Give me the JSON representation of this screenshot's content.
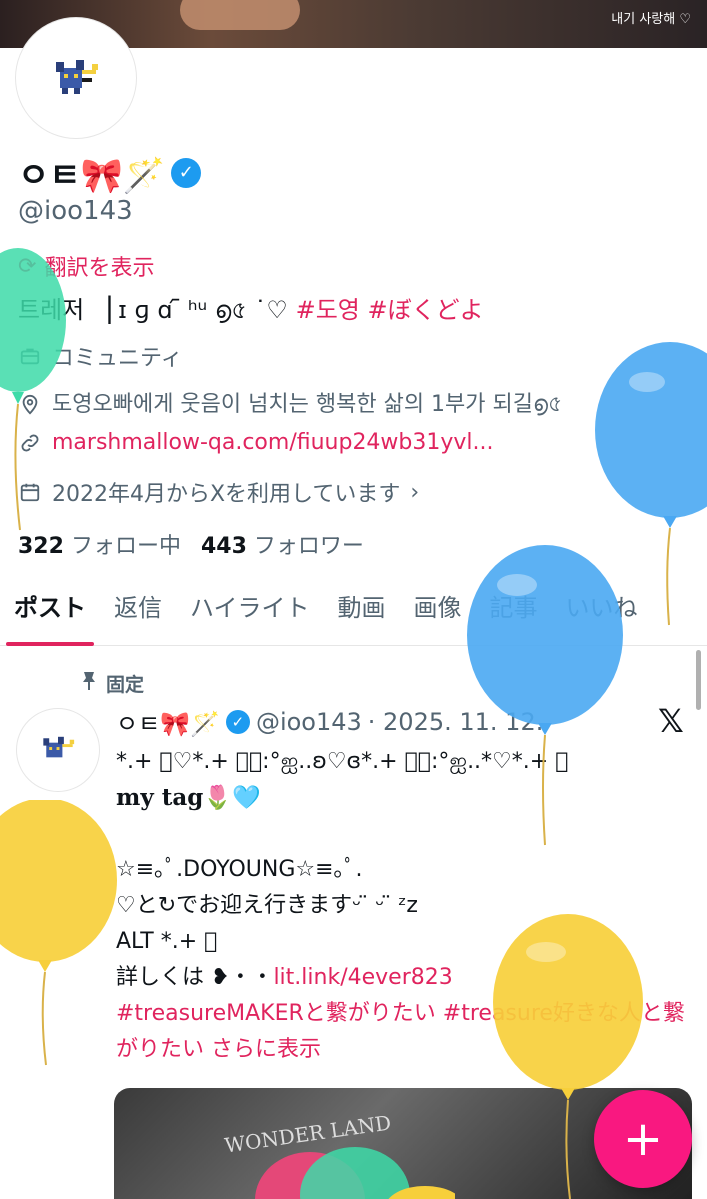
{
  "banner": {
    "caption": "내기 사랑해 ♡"
  },
  "profile": {
    "display_name": "ㅇㅌ🎀🪄",
    "verified_symbol": "✓",
    "handle": "@ioo143",
    "translate_label": "翻訳を表示",
    "bio_text": "트레저 ▕ ɪ ɡ ɑ ᷇ ʰᵘ ൭৫ ˙♡",
    "bio_hashtags": [
      "#도영",
      "#ぼくどよ"
    ],
    "category": "コミュニティ",
    "location": "도영오빠에게 웃음이 넘치는 행복한 삶의 1부가 되길൭৫",
    "url": "marshmallow-qa.com/fiuup24wb31yvl...",
    "joined": "2022年4月からXを利用しています",
    "following_count": "322",
    "following_label": "フォロー中",
    "followers_count": "443",
    "followers_label": "フォロワー"
  },
  "tabs": [
    "ポスト",
    "返信",
    "ハイライト",
    "動画",
    "画像",
    "記事",
    "いいね"
  ],
  "post": {
    "pinned_label": "固定",
    "author_name": "ㅇㅌ🎀🪄",
    "author_handle": "@ioo143",
    "date": "· 2025. 11. 12.",
    "lines": {
      "l1": "*.+ ゚♡*.+ ゚｡:°ஐ..ʚ♡ɞ*.+ ゚｡:°ஐ..*♡*.+ ゚",
      "l2": "my tag🌷🩵",
      "l3": "☆≡｡ﾟ.DOYOUNG☆≡｡ﾟ.",
      "l4": "♡と↻でお迎え行きますᵕ ̈ ᵕ ̈ ᶻz",
      "l5": "ALT *.+ ゚",
      "l6_prefix": "詳しくは ❥・・",
      "l6_link": "lit.link/4ever823",
      "tag1": "#treasureMAKERと繋がりたい",
      "tag2": "#treasure好きな人と繋がりたい",
      "more": "さらに表示"
    },
    "media_text": "WONDER LAND"
  },
  "fab_label": "+",
  "colors": {
    "accent": "#e0245e",
    "verified": "#1d9bf0",
    "fab": "#f91880"
  }
}
